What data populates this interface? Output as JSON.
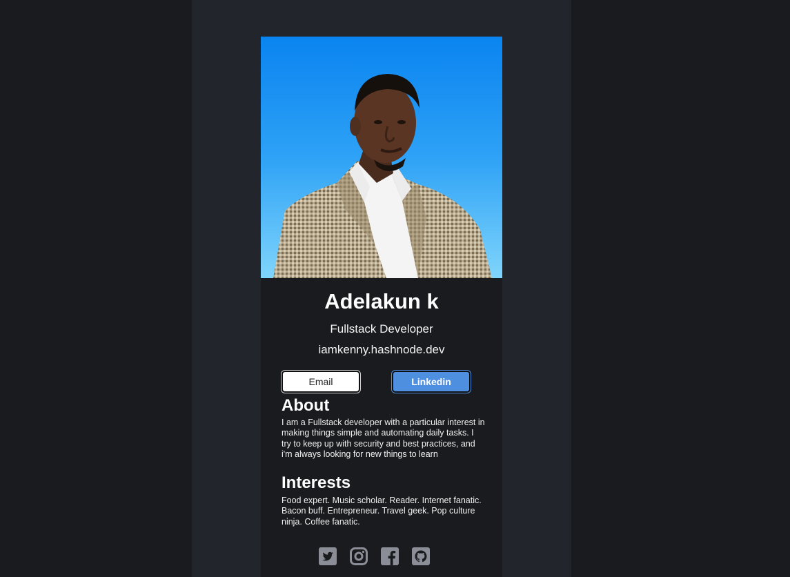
{
  "profile": {
    "name": "Adelakun k",
    "role": "Fullstack Developer",
    "website": "iamkenny.hashnode.dev",
    "photo_alt": "profile photo"
  },
  "buttons": {
    "email_label": "Email",
    "linkedin_label": "Linkedin"
  },
  "about": {
    "heading": "About",
    "text": "I am a Fullstack developer with a particular interest in making things simple and automating daily tasks. I try to keep up with security and best practices, and i'm always looking for new things to learn"
  },
  "interests": {
    "heading": "Interests",
    "text": "Food expert. Music scholar. Reader. Internet fanatic. Bacon buff. Entrepreneur. Travel geek. Pop culture ninja. Coffee fanatic."
  },
  "socials": [
    {
      "icon": "twitter-icon"
    },
    {
      "icon": "instagram-icon"
    },
    {
      "icon": "facebook-icon"
    },
    {
      "icon": "github-icon"
    }
  ],
  "colors": {
    "page_background": "#1a1b1f",
    "column_background": "#23252c",
    "card_background": "#1a1b1f",
    "linkedin_button": "#4f8fe0",
    "email_button": "#ffffff",
    "social_icon": "#8b8e96",
    "photo_sky_top": "#0a84f0",
    "photo_sky_bottom": "#7fd4fb"
  }
}
